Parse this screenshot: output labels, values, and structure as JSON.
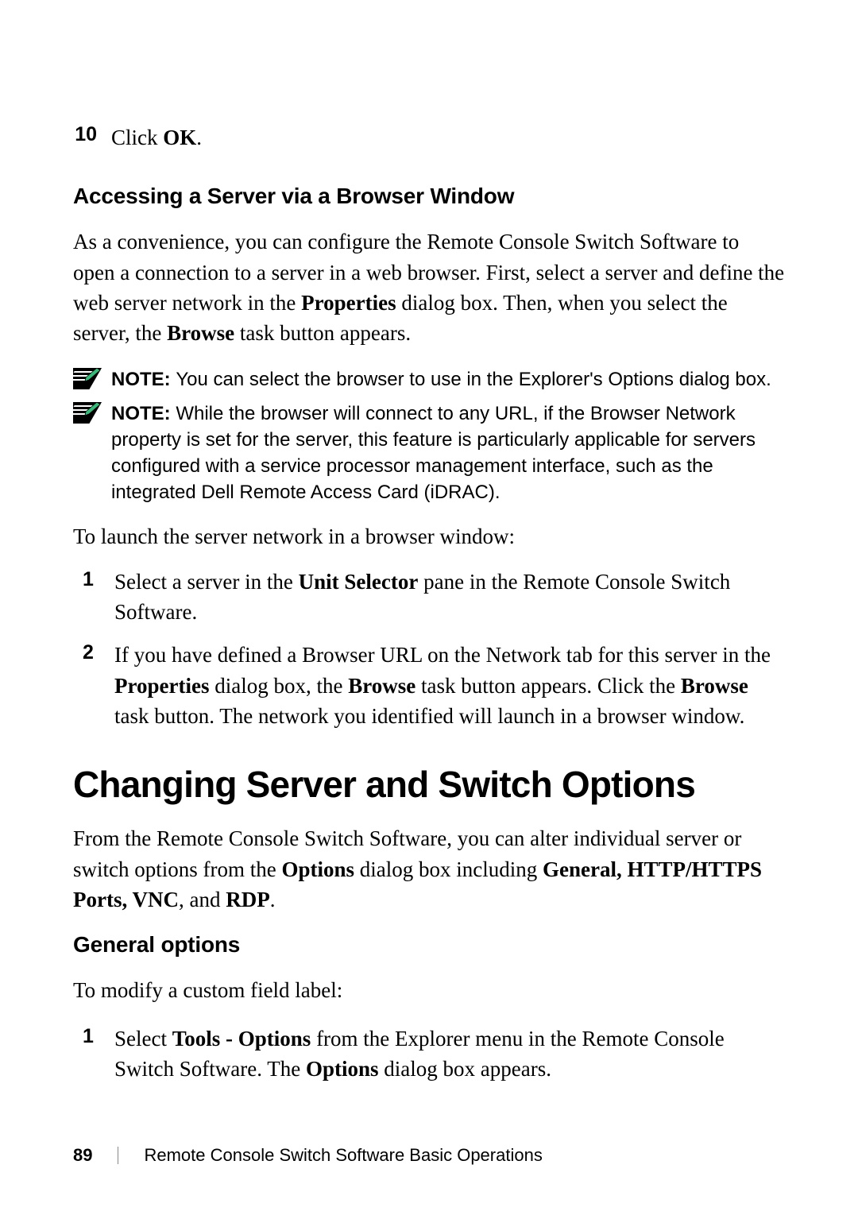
{
  "step10": {
    "num": "10",
    "pre": "Click ",
    "bold": "OK",
    "post": "."
  },
  "h_access": "Accessing a Server via a Browser Window",
  "p_access": {
    "t1": "As a convenience, you can configure the Remote Console Switch Software to open a connection to a server in a web browser. First, select a server and define the web server network in the ",
    "b1": "Properties",
    "t2": " dialog box. Then, when you select the server, the ",
    "b2": "Browse",
    "t3": " task button appears."
  },
  "note1": {
    "label": "NOTE: ",
    "text": "You can select the browser to use in the Explorer's Options dialog box."
  },
  "note2": {
    "label": "NOTE: ",
    "text": "While the browser will connect to any URL, if the Browser Network property is set for the server, this feature is particularly applicable for servers configured with a service processor management  interface, such as the integrated Dell Remote Access Card (iDRAC)."
  },
  "p_launch": "To launch the server network in a browser window:",
  "step1": {
    "num": "1",
    "t1": "Select a server in the ",
    "b1": "Unit Selector",
    "t2": " pane in the Remote Console Switch Software."
  },
  "step2": {
    "num": "2",
    "t1": "If you have defined a Browser URL on the Network tab for this server in the ",
    "b1": "Properties",
    "t2": " dialog box, the ",
    "b2": "Browse",
    "t3": " task button appears. Click the ",
    "b3": "Browse",
    "t4": " task button. The network you identified will launch in a browser window."
  },
  "h_change": "Changing Server and Switch Options",
  "p_change": {
    "t1": "From the Remote Console Switch Software, you can alter individual server or switch options from the ",
    "b1": "Options",
    "t2": " dialog box including ",
    "b2": "General, HTTP/HTTPS Ports, VNC",
    "t3": ", and ",
    "b3": "RDP",
    "t4": "."
  },
  "h_general": "General options",
  "p_modify": "To modify a custom field label:",
  "step_g1": {
    "num": "1",
    "t1": "Select ",
    "b1": "Tools - Options",
    "t2": " from the Explorer menu in the Remote Console Switch Software. The ",
    "b2": "Options",
    "t3": " dialog box appears."
  },
  "footer": {
    "page": "89",
    "title": "Remote Console Switch Software Basic Operations"
  }
}
